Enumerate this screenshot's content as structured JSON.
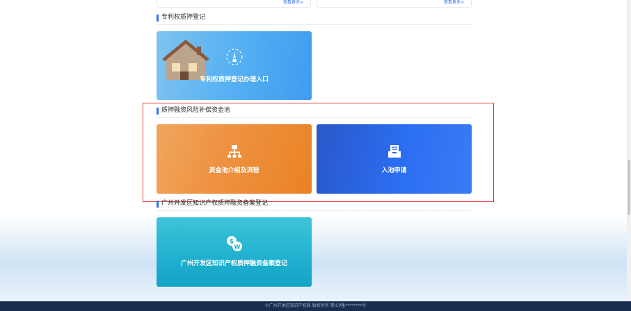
{
  "top_cards": [
    {
      "more_label": "查看更多>"
    },
    {
      "more_label": "查看更多>"
    }
  ],
  "sections": {
    "patent": {
      "title": "专利权质押登记",
      "tile_label": "专利权质押登记办理入口"
    },
    "fund_pool": {
      "title": "质押融资风险补偿资金池",
      "tiles": [
        {
          "label": "资金池介绍及流程"
        },
        {
          "label": "入池申请"
        }
      ]
    },
    "record": {
      "title": "广州开发区知识产权质押融资备案登记",
      "tile_label": "广州开发区知识产权质押融资备案登记"
    }
  },
  "footer": {
    "text": "©广州开发区知识产权局 版权所有 粤ICP备********号"
  },
  "colors": {
    "accent": "#2f6fe8",
    "highlight_border": "#e03a3a",
    "footer_bg": "#1a2f4f"
  },
  "icons": {
    "patent": "pen-nib-icon",
    "fund_pool": "org-chart-icon",
    "apply": "inbox-document-icon",
    "record": "currency-exchange-icon"
  }
}
